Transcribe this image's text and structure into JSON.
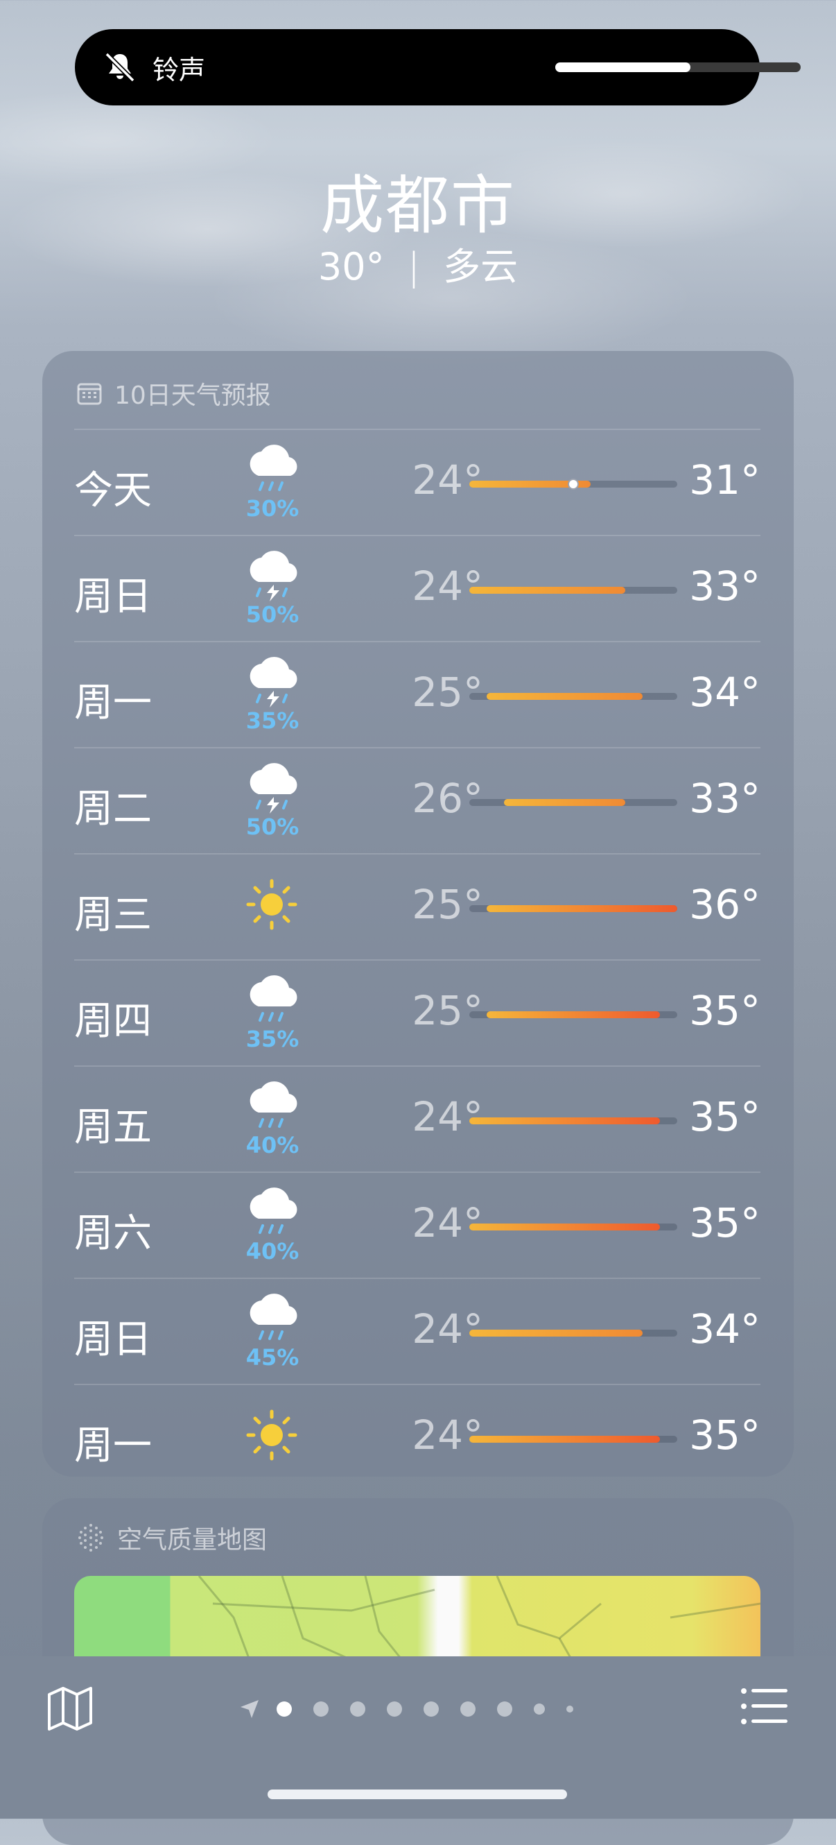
{
  "ringer": {
    "label": "铃声",
    "volume": 0.55
  },
  "location": {
    "city": "成都市",
    "current_temp": "30°",
    "separator": "|",
    "condition": "多云"
  },
  "forecast": {
    "title": "10日天气预报",
    "scale_min": 24,
    "scale_max": 36,
    "current_temp_value": 30,
    "days": [
      {
        "day": "今天",
        "icon": "rain-cloud-icon",
        "precip": "30%",
        "low": "24°",
        "high": "31°",
        "lo_v": 24,
        "hi_v": 31,
        "now": true
      },
      {
        "day": "周日",
        "icon": "thunderstorm-icon",
        "precip": "50%",
        "low": "24°",
        "high": "33°",
        "lo_v": 24,
        "hi_v": 33
      },
      {
        "day": "周一",
        "icon": "thunderstorm-icon",
        "precip": "35%",
        "low": "25°",
        "high": "34°",
        "lo_v": 25,
        "hi_v": 34
      },
      {
        "day": "周二",
        "icon": "thunderstorm-icon",
        "precip": "50%",
        "low": "26°",
        "high": "33°",
        "lo_v": 26,
        "hi_v": 33
      },
      {
        "day": "周三",
        "icon": "sun-icon",
        "precip": "",
        "low": "25°",
        "high": "36°",
        "lo_v": 25,
        "hi_v": 36
      },
      {
        "day": "周四",
        "icon": "rain-cloud-icon",
        "precip": "35%",
        "low": "25°",
        "high": "35°",
        "lo_v": 25,
        "hi_v": 35
      },
      {
        "day": "周五",
        "icon": "rain-cloud-icon",
        "precip": "40%",
        "low": "24°",
        "high": "35°",
        "lo_v": 24,
        "hi_v": 35
      },
      {
        "day": "周六",
        "icon": "rain-cloud-icon",
        "precip": "40%",
        "low": "24°",
        "high": "35°",
        "lo_v": 24,
        "hi_v": 35
      },
      {
        "day": "周日",
        "icon": "rain-cloud-icon",
        "precip": "45%",
        "low": "24°",
        "high": "34°",
        "lo_v": 24,
        "hi_v": 34
      },
      {
        "day": "周一",
        "icon": "sun-icon",
        "precip": "",
        "low": "24°",
        "high": "35°",
        "lo_v": 24,
        "hi_v": 35
      }
    ]
  },
  "air_quality": {
    "title": "空气质量地图"
  },
  "toolbar": {
    "page_count": 9,
    "active_page": 1
  },
  "colors": {
    "precip": "#6ec1f5",
    "bar_cool": "#f5b63a",
    "bar_hot": "#ee5a2e"
  }
}
